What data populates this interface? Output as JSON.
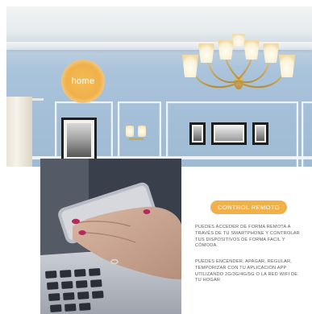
{
  "badge": {
    "label": "home"
  },
  "cta": {
    "label": "CONTROL REMOTO"
  },
  "paragraphs": [
    "PUEDES ACCEDER DE FORMA REMOTA A TRAVÉS DE TU SMARTPHONE Y CONTROLAR TUS DISPOSITIVOS DE FORMA FACIL Y CÓMODA.",
    "PUEDES ENCENDER, APAGAR, REGULAR, TEMPORIZAR CON TU APLICACIÓN APP UTILIZANDO 2G/3G/4G/5G O LA RED WIFI DE TU HOGAR"
  ],
  "colors": {
    "accent": "#f0b04a",
    "wall": "#a9c3db",
    "text": "#5a5a5a"
  },
  "images": {
    "top": "living-room-chandelier-photo",
    "bottom": "hand-holding-smartphone-photo"
  }
}
